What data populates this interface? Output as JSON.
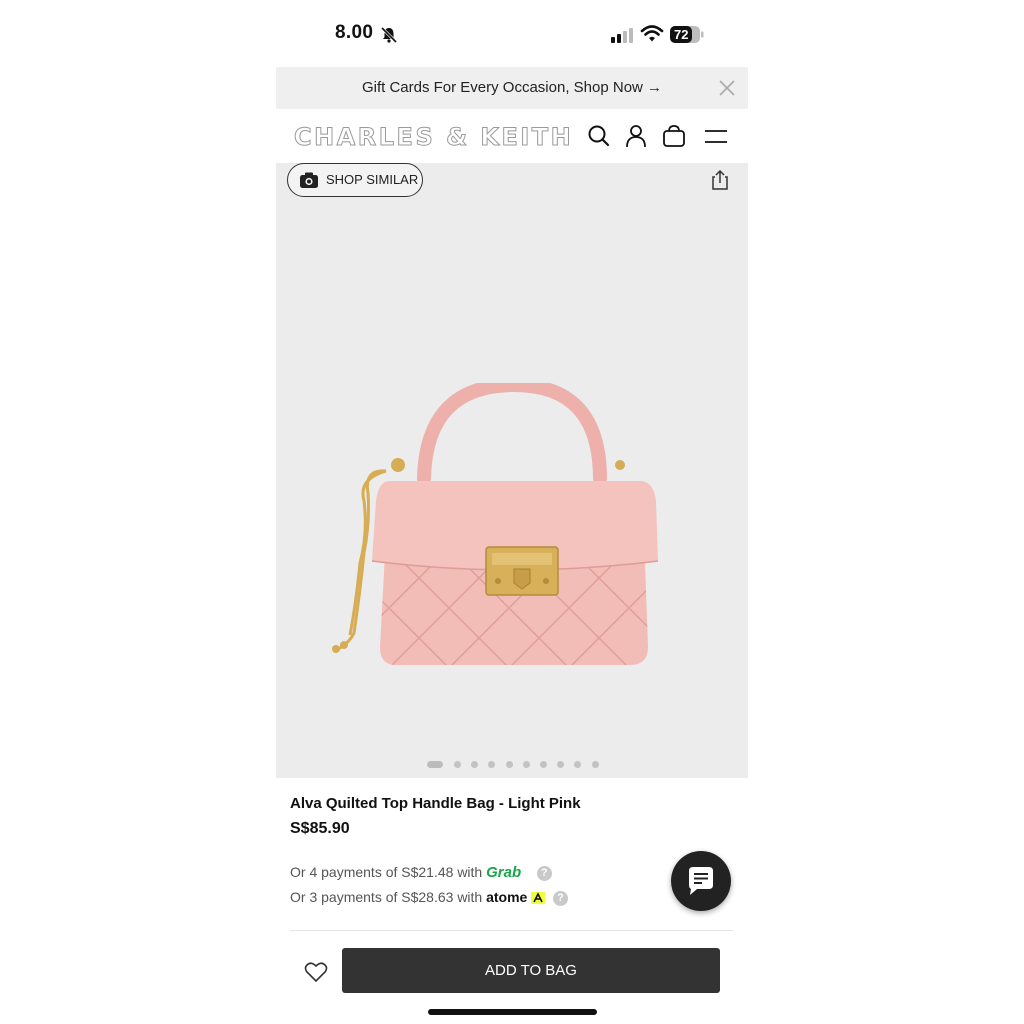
{
  "status_bar": {
    "time": "8.00",
    "battery": "72"
  },
  "promo": {
    "text": "Gift Cards For Every Occasion, Shop Now →"
  },
  "header": {
    "brand": "CHARLES & KEITH",
    "icons": [
      "search-icon",
      "account-icon",
      "bag-icon",
      "menu-icon"
    ]
  },
  "gallery": {
    "shop_similar": "SHOP SIMILAR",
    "slide_count": 10,
    "active_slide": 1,
    "background": "#ececec"
  },
  "product": {
    "title": "Alva Quilted Top Handle Bag - Light Pink",
    "price": "S$85.90",
    "pay_grab_prefix": "Or 4 payments of S$21.48 with",
    "grab_logo": "Grab",
    "pay_atome_prefix": "Or 3 payments of S$28.63 with",
    "atome_logo": "atome"
  },
  "actions": {
    "add_to_bag": "ADD TO BAG"
  },
  "colors": {
    "bag_pink": "#f1b9b4",
    "hardware_gold": "#d6ad55",
    "button_dark": "#333333",
    "grab_green": "#1aa64a"
  }
}
